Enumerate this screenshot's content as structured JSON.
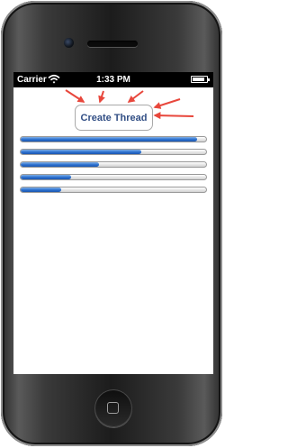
{
  "status_bar": {
    "carrier": "Carrier",
    "time": "1:33 PM",
    "battery_level": 0.85,
    "wifi_icon": "wifi-icon",
    "battery_icon": "battery-icon"
  },
  "main": {
    "create_thread_label": "Create Thread",
    "accent_color": "#324f85",
    "progress_color": "#2a6fcf",
    "annotation_color": "#e8473c",
    "progress_bars": [
      {
        "progress": 0.95
      },
      {
        "progress": 0.65
      },
      {
        "progress": 0.42
      },
      {
        "progress": 0.27
      },
      {
        "progress": 0.22
      }
    ]
  },
  "hardware": {
    "speaker_icon": "speaker-grille",
    "camera_icon": "front-camera-icon",
    "home_icon": "home-button-icon"
  }
}
